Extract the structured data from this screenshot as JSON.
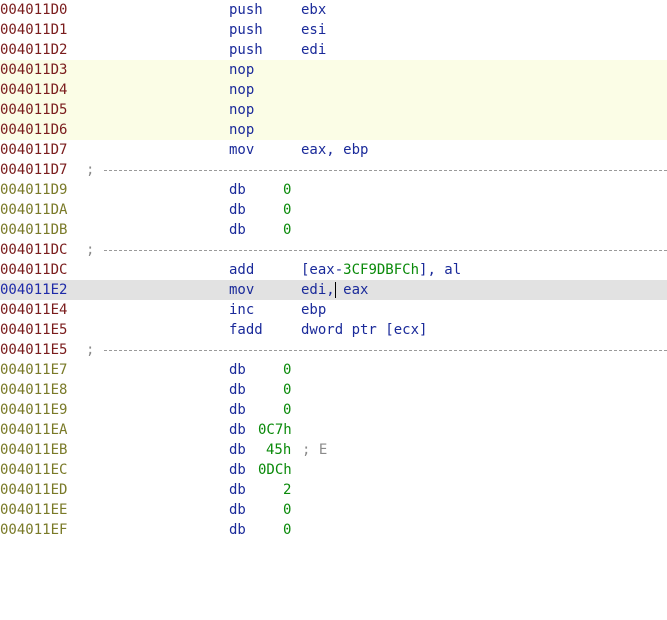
{
  "colors": {
    "code_address": "#7a1c1c",
    "data_address": "#7a7a28",
    "current_address": "#1e2aa8",
    "mnemonic": "#1a2a9a",
    "number": "#0a8a0a",
    "comment": "#8a8a8a",
    "highlight_nop": "#fbfde6",
    "highlight_current": "#e2e2e2"
  },
  "listing": {
    "separator_char": ";",
    "r0": {
      "addr": "004011D0",
      "mnem": "push",
      "ops": "ebx"
    },
    "r1": {
      "addr": "004011D1",
      "mnem": "push",
      "ops": "esi"
    },
    "r2": {
      "addr": "004011D2",
      "mnem": "push",
      "ops": "edi"
    },
    "r3": {
      "addr": "004011D3",
      "mnem": "nop"
    },
    "r4": {
      "addr": "004011D4",
      "mnem": "nop"
    },
    "r5": {
      "addr": "004011D5",
      "mnem": "nop"
    },
    "r6": {
      "addr": "004011D6",
      "mnem": "nop"
    },
    "r7": {
      "addr": "004011D7",
      "mnem": "mov",
      "ops": "eax, ebp"
    },
    "r8": {
      "addr": "004011D7"
    },
    "r9": {
      "addr": "004011D9",
      "mnem": "db",
      "val": "0"
    },
    "r10": {
      "addr": "004011DA",
      "mnem": "db",
      "val": "0"
    },
    "r11": {
      "addr": "004011DB",
      "mnem": "db",
      "val": "0"
    },
    "r12": {
      "addr": "004011DC"
    },
    "r13": {
      "addr": "004011DC",
      "mnem": "add",
      "ops_pre": "[eax-",
      "ops_num": "3CF9DBFCh",
      "ops_post": "], al"
    },
    "r14": {
      "addr": "004011E2",
      "mnem": "mov",
      "ops": "edi, eax"
    },
    "r15": {
      "addr": "004011E4",
      "mnem": "inc",
      "ops": "ebp"
    },
    "r16": {
      "addr": "004011E5",
      "mnem": "fadd",
      "ops": "dword ptr [ecx]"
    },
    "r17": {
      "addr": "004011E5"
    },
    "r18": {
      "addr": "004011E7",
      "mnem": "db",
      "val": "0"
    },
    "r19": {
      "addr": "004011E8",
      "mnem": "db",
      "val": "0"
    },
    "r20": {
      "addr": "004011E9",
      "mnem": "db",
      "val": "0"
    },
    "r21": {
      "addr": "004011EA",
      "mnem": "db",
      "val": "0C7h"
    },
    "r22": {
      "addr": "004011EB",
      "mnem": "db",
      "val": "45h",
      "comment": "; E"
    },
    "r23": {
      "addr": "004011EC",
      "mnem": "db",
      "val": "0DCh"
    },
    "r24": {
      "addr": "004011ED",
      "mnem": "db",
      "val": "2"
    },
    "r25": {
      "addr": "004011EE",
      "mnem": "db",
      "val": "0"
    },
    "r26": {
      "addr": "004011EF",
      "mnem": "db",
      "val": "0"
    }
  }
}
